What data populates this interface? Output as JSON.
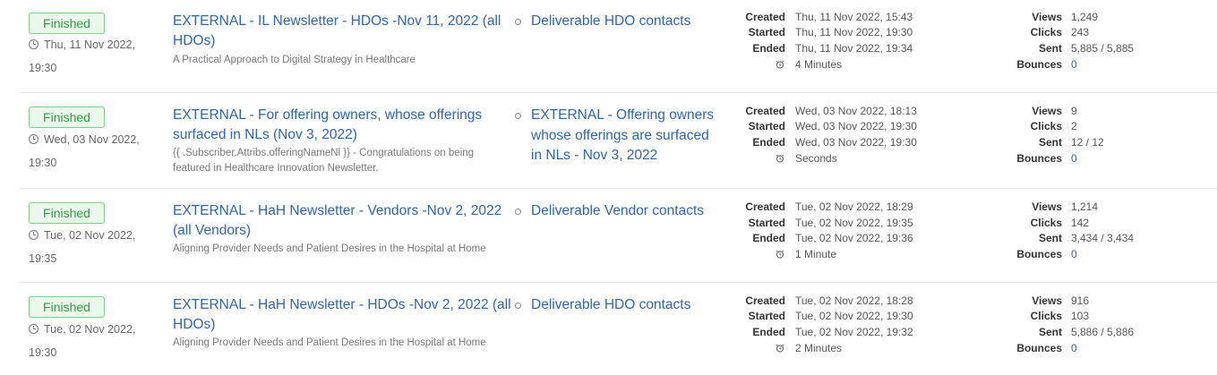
{
  "labels": {
    "created": "Created",
    "started": "Started",
    "ended": "Ended",
    "views": "Views",
    "clicks": "Clicks",
    "sent": "Sent",
    "bounces": "Bounces"
  },
  "campaigns": [
    {
      "status": "Finished",
      "scheduled_line1": "Thu, 11 Nov 2022,",
      "scheduled_line2": "19:30",
      "title": "EXTERNAL - IL Newsletter - HDOs -Nov 11, 2022 (all HDOs)",
      "subject": "A Practical Approach to Digital Strategy in Healthcare",
      "list": "Deliverable HDO contacts",
      "created": "Thu, 11 Nov 2022, 15:43",
      "started": "Thu, 11 Nov 2022, 19:30",
      "ended": "Thu, 11 Nov 2022, 19:34",
      "duration": "4 Minutes",
      "views": "1,249",
      "clicks": "243",
      "sent": "5,885 / 5,885",
      "bounces": "0"
    },
    {
      "status": "Finished",
      "scheduled_line1": "Wed, 03 Nov 2022,",
      "scheduled_line2": "19:30",
      "title": "EXTERNAL - For offering owners, whose offerings surfaced in NLs (Nov 3, 2022)",
      "subject": "{{ .Subscriber.Attribs.offeringNameNl }} - Congratulations on being featured in Healthcare Innovation Newsletter.",
      "list": "EXTERNAL - Offering owners whose offerings are surfaced in NLs - Nov 3, 2022",
      "created": "Wed, 03 Nov 2022, 18:13",
      "started": "Wed, 03 Nov 2022, 19:30",
      "ended": "Wed, 03 Nov 2022, 19:30",
      "duration": "Seconds",
      "views": "9",
      "clicks": "2",
      "sent": "12 / 12",
      "bounces": "0"
    },
    {
      "status": "Finished",
      "scheduled_line1": "Tue, 02 Nov 2022,",
      "scheduled_line2": "19:35",
      "title": "EXTERNAL - HaH Newsletter - Vendors -Nov 2, 2022 (all Vendors)",
      "subject": "Aligning Provider Needs and Patient Desires in the Hospital at Home",
      "list": "Deliverable Vendor contacts",
      "created": "Tue, 02 Nov 2022, 18:29",
      "started": "Tue, 02 Nov 2022, 19:35",
      "ended": "Tue, 02 Nov 2022, 19:36",
      "duration": "1 Minute",
      "views": "1,214",
      "clicks": "142",
      "sent": "3,434 / 3,434",
      "bounces": "0"
    },
    {
      "status": "Finished",
      "scheduled_line1": "Tue, 02 Nov 2022,",
      "scheduled_line2": "19:30",
      "title": "EXTERNAL - HaH Newsletter - HDOs -Nov 2, 2022 (all HDOs)",
      "subject": "Aligning Provider Needs and Patient Desires in the Hospital at Home",
      "list": "Deliverable HDO contacts",
      "created": "Tue, 02 Nov 2022, 18:28",
      "started": "Tue, 02 Nov 2022, 19:30",
      "ended": "Tue, 02 Nov 2022, 19:32",
      "duration": "2 Minutes",
      "views": "916",
      "clicks": "103",
      "sent": "5,886 / 5,886",
      "bounces": "0"
    }
  ],
  "colors": {
    "link": "#2c64b8",
    "status_finished_text": "#2e9e3e",
    "status_finished_bg": "#eaf8ec",
    "status_finished_border": "#7fcf8a"
  },
  "icons": [
    "clock-icon",
    "alarm-clock-icon",
    "list-bullet-icon"
  ]
}
